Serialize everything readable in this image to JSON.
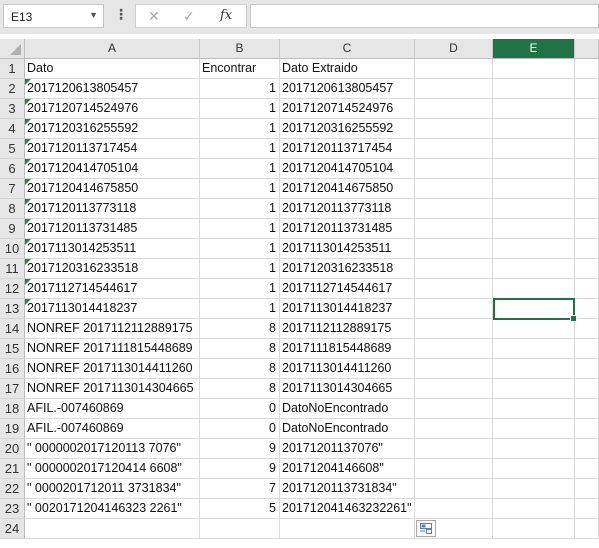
{
  "formula_bar": {
    "name_box": "E13",
    "name_box_arrow": "▼",
    "cancel_glyph": "✕",
    "enter_glyph": "✓",
    "fx_label": "fx",
    "formula_value": ""
  },
  "columns": [
    "A",
    "B",
    "C",
    "D",
    "E"
  ],
  "active_column": "E",
  "active_cell": "E13",
  "header_row": {
    "a": "Dato",
    "b": "Encontrar",
    "c": "Dato Extraido"
  },
  "rows": [
    {
      "a": "2017120613805457",
      "b": "1",
      "c": "2017120613805457",
      "warn": true
    },
    {
      "a": "2017120714524976",
      "b": "1",
      "c": "2017120714524976",
      "warn": true
    },
    {
      "a": "2017120316255592",
      "b": "1",
      "c": "2017120316255592",
      "warn": true
    },
    {
      "a": "2017120113717454",
      "b": "1",
      "c": "2017120113717454",
      "warn": true
    },
    {
      "a": "2017120414705104",
      "b": "1",
      "c": "2017120414705104",
      "warn": true
    },
    {
      "a": "2017120414675850",
      "b": "1",
      "c": "2017120414675850",
      "warn": true
    },
    {
      "a": "2017120113773118",
      "b": "1",
      "c": "2017120113773118",
      "warn": true
    },
    {
      "a": "2017120113731485",
      "b": "1",
      "c": "2017120113731485",
      "warn": true
    },
    {
      "a": "2017113014253511",
      "b": "1",
      "c": "2017113014253511",
      "warn": true
    },
    {
      "a": "2017120316233518",
      "b": "1",
      "c": "2017120316233518",
      "warn": true
    },
    {
      "a": "2017112714544617",
      "b": "1",
      "c": "2017112714544617",
      "warn": true
    },
    {
      "a": "2017113014418237",
      "b": "1",
      "c": "2017113014418237",
      "warn": true
    },
    {
      "a": "NONREF 2017112112889175",
      "b": "8",
      "c": "2017112112889175",
      "warn": false
    },
    {
      "a": "NONREF 2017111815448689",
      "b": "8",
      "c": "2017111815448689",
      "warn": false
    },
    {
      "a": "NONREF 2017113014411260",
      "b": "8",
      "c": "2017113014411260",
      "warn": false
    },
    {
      "a": "NONREF 2017113014304665",
      "b": "8",
      "c": "2017113014304665",
      "warn": false
    },
    {
      "a": "AFIL.-007460869",
      "b": "0",
      "c": "DatoNoEncontrado",
      "warn": false
    },
    {
      "a": "AFIL.-007460869",
      "b": "0",
      "c": "DatoNoEncontrado",
      "warn": false
    },
    {
      "a": "\" 0000002017120113 7076\"",
      "b": "9",
      "c": "20171201137076\"",
      "warn": false
    },
    {
      "a": "\" 0000002017120414 6608\"",
      "b": "9",
      "c": "20171204146608\"",
      "warn": false
    },
    {
      "a": "\" 0000201712011 3731834\"",
      "b": "7",
      "c": "2017120113731834\"",
      "warn": false
    },
    {
      "a": "\" 0020171204146323 2261\"",
      "b": "5",
      "c": "201712041463232261\"",
      "warn": false
    }
  ],
  "row_numbers": [
    "1",
    "2",
    "3",
    "4",
    "5",
    "6",
    "7",
    "8",
    "9",
    "10",
    "11",
    "12",
    "13",
    "14",
    "15",
    "16",
    "17",
    "18",
    "19",
    "20",
    "21",
    "22",
    "23",
    "24"
  ]
}
